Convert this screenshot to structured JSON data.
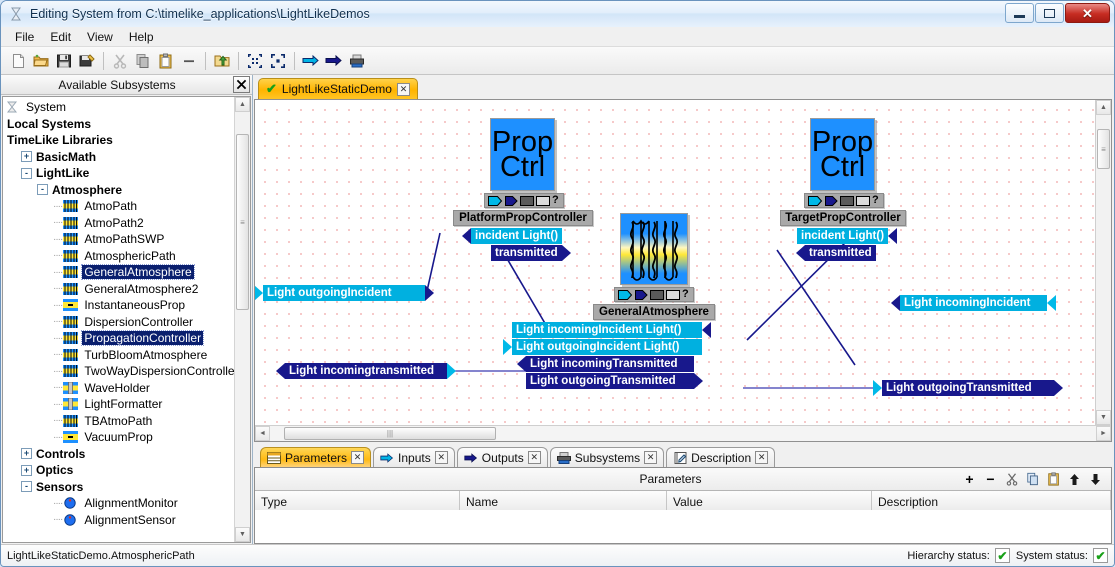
{
  "window": {
    "title": "Editing System  from C:\\timelike_applications\\LightLikeDemos",
    "app_icon": "hourglass-icon",
    "minimize": "–",
    "maximize": "□",
    "close": "✕"
  },
  "menubar": {
    "items": [
      "File",
      "Edit",
      "View",
      "Help"
    ]
  },
  "toolbar": {
    "buttons": [
      "new-document-icon",
      "open-folder-icon",
      "save-icon",
      "save-all-icon",
      "cut-icon",
      "copy-icon",
      "paste-icon",
      "delete-icon",
      "export-folder-icon",
      "zoom-shrink-icon",
      "zoom-expand-icon",
      "run-step-icon",
      "run-icon",
      "print-icon"
    ]
  },
  "sidebar": {
    "title": "Available Subsystems",
    "close_label": "✕",
    "items": [
      {
        "label": "System",
        "depth": 0,
        "bold": false,
        "icon": "hourglass-icon",
        "expander": ""
      },
      {
        "label": "Local Systems",
        "depth": 0,
        "bold": true,
        "icon": "",
        "expander": ""
      },
      {
        "label": "TimeLike Libraries",
        "depth": 0,
        "bold": true,
        "icon": "",
        "expander": ""
      },
      {
        "label": "BasicMath",
        "depth": 1,
        "bold": true,
        "icon": "",
        "expander": "+"
      },
      {
        "label": "LightLike",
        "depth": 1,
        "bold": true,
        "icon": "",
        "expander": "-"
      },
      {
        "label": "Atmosphere",
        "depth": 2,
        "bold": true,
        "icon": "",
        "expander": "-"
      },
      {
        "label": "AtmoPath",
        "depth": 3,
        "bold": false,
        "icon": "atmosphere-icon",
        "expander": ""
      },
      {
        "label": "AtmoPath2",
        "depth": 3,
        "bold": false,
        "icon": "atmosphere-icon",
        "expander": ""
      },
      {
        "label": "AtmoPathSWP",
        "depth": 3,
        "bold": false,
        "icon": "atmosphere-icon",
        "expander": ""
      },
      {
        "label": "AtmosphericPath",
        "depth": 3,
        "bold": false,
        "icon": "atmosphere-icon",
        "expander": ""
      },
      {
        "label": "GeneralAtmosphere",
        "depth": 3,
        "bold": false,
        "icon": "atmosphere-icon",
        "expander": "",
        "selected": true
      },
      {
        "label": "GeneralAtmosphere2",
        "depth": 3,
        "bold": false,
        "icon": "atmosphere-icon",
        "expander": ""
      },
      {
        "label": "InstantaneousProp",
        "depth": 3,
        "bold": false,
        "icon": "prop-icon",
        "expander": ""
      },
      {
        "label": "DispersionController",
        "depth": 3,
        "bold": false,
        "icon": "atmosphere-icon",
        "expander": ""
      },
      {
        "label": "PropagationController",
        "depth": 3,
        "bold": false,
        "icon": "atmosphere-icon",
        "expander": "",
        "selected": true
      },
      {
        "label": "TurbBloomAtmosphere",
        "depth": 3,
        "bold": false,
        "icon": "atmosphere-icon",
        "expander": ""
      },
      {
        "label": "TwoWayDispersionController",
        "depth": 3,
        "bold": false,
        "icon": "atmosphere-icon",
        "expander": ""
      },
      {
        "label": "WaveHolder",
        "depth": 3,
        "bold": false,
        "icon": "wave-holder-icon",
        "expander": ""
      },
      {
        "label": "LightFormatter",
        "depth": 3,
        "bold": false,
        "icon": "wave-holder-icon",
        "expander": ""
      },
      {
        "label": "TBAtmoPath",
        "depth": 3,
        "bold": false,
        "icon": "atmosphere-icon",
        "expander": ""
      },
      {
        "label": "VacuumProp",
        "depth": 3,
        "bold": false,
        "icon": "prop-icon",
        "expander": ""
      },
      {
        "label": "Controls",
        "depth": 1,
        "bold": true,
        "icon": "",
        "expander": "+"
      },
      {
        "label": "Optics",
        "depth": 1,
        "bold": true,
        "icon": "",
        "expander": "+"
      },
      {
        "label": "Sensors",
        "depth": 1,
        "bold": true,
        "icon": "",
        "expander": "-"
      },
      {
        "label": "AlignmentMonitor",
        "depth": 3,
        "bold": false,
        "icon": "sensor-icon",
        "expander": ""
      },
      {
        "label": "AlignmentSensor",
        "depth": 3,
        "bold": false,
        "icon": "sensor-icon",
        "expander": ""
      }
    ]
  },
  "canvas": {
    "tab": {
      "label": "LightLikeStaticDemo",
      "status_icon": "green-check-icon",
      "close_label": "✕"
    },
    "blocks": [
      {
        "id": "platform",
        "icon_text_1": "Prop",
        "icon_text_2": "Ctrl",
        "name": "PlatformPropController",
        "strip": [
          "input-port-icon",
          "output-port-icon",
          "dark-box-icon",
          "light-box-icon",
          "?"
        ]
      },
      {
        "id": "atmosphere",
        "icon_text_1": "",
        "icon_text_2": "",
        "name": "GeneralAtmosphere",
        "strip": [
          "input-port-icon",
          "output-port-icon",
          "dark-box-icon",
          "light-box-icon",
          "?"
        ]
      },
      {
        "id": "target",
        "icon_text_1": "Prop",
        "icon_text_2": "Ctrl",
        "name": "TargetPropController",
        "strip": [
          "input-port-icon",
          "output-port-icon",
          "dark-box-icon",
          "light-box-icon",
          "?"
        ]
      }
    ],
    "ports": {
      "platform_incident": "incident  Light()",
      "platform_transmitted": "transmitted",
      "target_incident": "incident  Light()",
      "target_transmitted": "transmitted",
      "atmo_incoming_incident": "Light  incomingIncident  Light()",
      "atmo_outgoing_incident": "Light  outgoingIncident   Light()",
      "atmo_incoming_transmitted": "Light  incomingTransmitted",
      "atmo_outgoing_transmitted": "Light  outgoingTransmitted",
      "left_outgoing_incident": "Light  outgoingIncident",
      "left_incoming_transmitted": "Light  incomingtransmitted",
      "right_incoming_incident": "Light  incomingIncident",
      "right_outgoing_transmitted": "Light  outgoingTransmitted"
    }
  },
  "bottom": {
    "tabs": [
      {
        "label": "Parameters",
        "icon": "table-icon",
        "active": true,
        "close": "✕"
      },
      {
        "label": "Inputs",
        "icon": "input-arrow-icon",
        "active": false,
        "close": "✕"
      },
      {
        "label": "Outputs",
        "icon": "output-arrow-icon",
        "active": false,
        "close": "✕"
      },
      {
        "label": "Subsystems",
        "icon": "stack-icon",
        "active": false,
        "close": "✕"
      },
      {
        "label": "Description",
        "icon": "notepad-icon",
        "active": false,
        "close": "✕"
      }
    ],
    "panel_title": "Parameters",
    "actions": [
      "add-icon",
      "remove-icon",
      "cut-icon",
      "copy-icon",
      "paste-icon",
      "move-up-icon",
      "move-down-icon"
    ],
    "columns": [
      "Type",
      "Name",
      "Value",
      "Description"
    ],
    "rows": []
  },
  "statusbar": {
    "path": "LightLikeStaticDemo.AtmosphericPath",
    "hierarchy_label": "Hierarchy status:",
    "hierarchy_state": "✔",
    "system_label": "System status:",
    "system_state": "✔"
  }
}
